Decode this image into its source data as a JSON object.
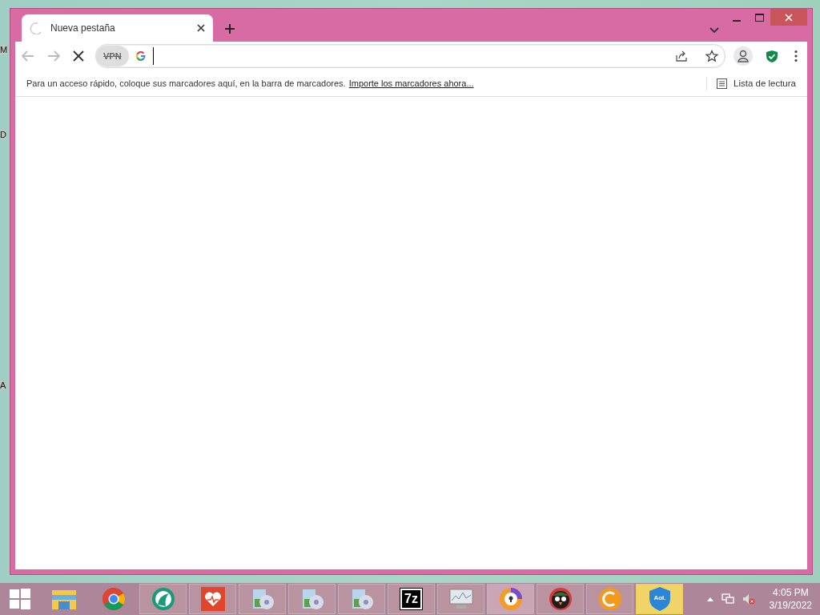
{
  "desktop_labels": [
    "M",
    "D",
    "A"
  ],
  "tabs": [
    {
      "label": "Nueva pestaña",
      "selected": true,
      "loading": true
    }
  ],
  "toolbar": {
    "back_disabled": true,
    "forward_disabled": true,
    "loading": true,
    "vpn_label": "VPN"
  },
  "bookmarks_bar": {
    "message": "Para un acceso rápido, coloque sus marcadores aquí, en la barra de marcadores.",
    "link": "Importe los marcadores ahora...",
    "reading_list": "Lista de lectura"
  },
  "taskbar": {
    "items": [
      {
        "kind": "explorer",
        "running": false,
        "selected": false
      },
      {
        "kind": "chrome",
        "running": false,
        "selected": false
      },
      {
        "kind": "green",
        "running": true,
        "selected": false
      },
      {
        "kind": "heart",
        "running": true,
        "selected": false
      },
      {
        "kind": "installer",
        "running": true,
        "selected": false
      },
      {
        "kind": "installer",
        "running": true,
        "selected": false
      },
      {
        "kind": "installer",
        "running": true,
        "selected": false
      },
      {
        "kind": "sevenzip",
        "label": "7z",
        "running": true,
        "selected": false
      },
      {
        "kind": "monitor",
        "running": true,
        "selected": false
      },
      {
        "kind": "lock",
        "running": true,
        "selected": true
      },
      {
        "kind": "bird",
        "running": true,
        "selected": false
      },
      {
        "kind": "coin",
        "running": true,
        "selected": false
      },
      {
        "kind": "aol",
        "label": "Aol.",
        "running": true,
        "selected": false,
        "flashing": true
      }
    ],
    "tray": {
      "muted": true,
      "time": "4:05 PM",
      "date": "3/19/2022"
    }
  }
}
